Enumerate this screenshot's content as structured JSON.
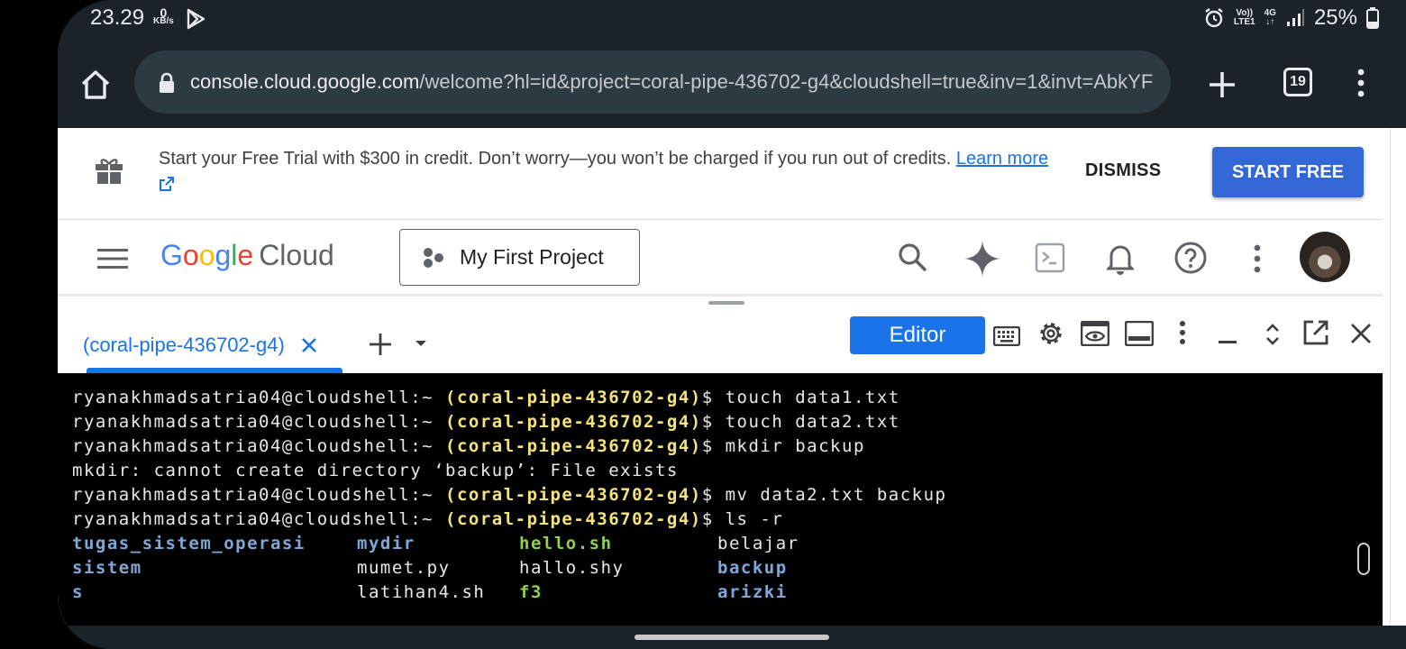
{
  "status": {
    "time": "23.29",
    "speed_value": "0",
    "speed_unit": "KB/s",
    "network_volte": "Vo))",
    "network_lte": "LTE1",
    "network_type": "4G",
    "battery": "25%"
  },
  "browser": {
    "url_host": "console.cloud.google.com",
    "url_path": "/welcome?hl=id&project=coral-pipe-436702-g4&cloudshell=true&inv=1&invt=AbkYF",
    "tab_count": "19"
  },
  "banner": {
    "text": "Start your Free Trial with $300 in credit. Don’t worry—you won’t be charged if you run out of credits. ",
    "link": "Learn more",
    "dismiss": "DISMISS",
    "start_free": "START FREE"
  },
  "header": {
    "logo_cloud": "Cloud",
    "project": "My First Project"
  },
  "shell": {
    "tab_label": "(coral-pipe-436702-g4)",
    "editor_label": "Editor"
  },
  "terminal": {
    "prompt_user": "ryanakhmadsatria04@cloudshell:~ ",
    "prompt_project": "(coral-pipe-436702-g4)",
    "prompt_symbol": "$ ",
    "commands": [
      "touch data1.txt",
      "touch data2.txt",
      "mkdir backup"
    ],
    "error_line": "mkdir: cannot create directory ‘backup’: File exists",
    "commands_after": [
      "mv data2.txt backup",
      "ls -r"
    ],
    "ls_rows": [
      [
        "tugas_sistem_operasi",
        "mydir",
        "hello.sh",
        "belajar"
      ],
      [
        "sistem",
        "mumet.py",
        "hallo.shy",
        "backup"
      ],
      [
        "s",
        "latihan4.sh",
        "f3",
        "arizki"
      ]
    ]
  },
  "colors": {
    "accent": "#1a73e8",
    "start_free": "#3367d6",
    "terminal_project": "#f4e27a",
    "terminal_dir": "#7fa7d9",
    "terminal_exe": "#8fd14f"
  }
}
